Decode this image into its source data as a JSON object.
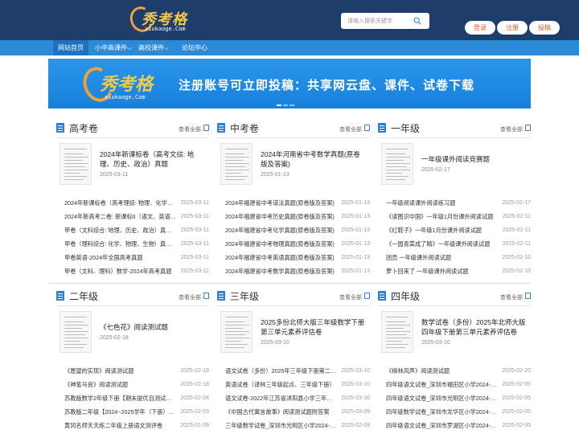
{
  "header": {
    "logo_name": "秀考格",
    "logo_domain": "xiukaoge.Com",
    "search_placeholder": "请输入搜索关键字",
    "buttons": [
      "登录",
      "注册",
      "投稿"
    ]
  },
  "nav": {
    "items": [
      "网站首页",
      "小中高课件⌵",
      "高校课件⌵",
      "论坛中心"
    ]
  },
  "banner": {
    "logo_name": "秀考格",
    "logo_domain": "xiukaoge.Com",
    "text": "注册账号可立即投稿：共享网云盘、课件、试卷下载"
  },
  "more_label": "查看全部",
  "sections": [
    {
      "title": "高考卷",
      "featured": {
        "title": "2024年新课标卷（高考文综: 地理、历史、政治）真题",
        "date": "2025-03-11"
      },
      "items": [
        {
          "title": "2024年新课标卷（高考理综: 物理、化学、生物）真题",
          "date": "2025-03-11"
        },
        {
          "title": "2024年新高考二卷: 新课标II（语文、英语、数学）",
          "date": "2025-03-11"
        },
        {
          "title": "甲卷（文科综合: 地理、历史、政治）真题-2024年高考",
          "date": "2025-03-11"
        },
        {
          "title": "甲卷（理科综合: 化学、物理、生物）真题-2024年",
          "date": "2025-03-11"
        },
        {
          "title": "甲卷英语-2024年全国高考真题",
          "date": "2025-03-11"
        },
        {
          "title": "甲卷（文科、理科）数学-2024年高考真题",
          "date": "2025-03-11"
        }
      ]
    },
    {
      "title": "中考卷",
      "featured": {
        "title": "2024年河南省中考数学真题(原卷版及答案)",
        "date": "2025-01-13"
      },
      "items": [
        {
          "title": "2024年福建省中考道法真题(原卷版及答案)",
          "date": "2025-01-13"
        },
        {
          "title": "2024年福建省中考历史真题(原卷版及答案)",
          "date": "2025-01-13"
        },
        {
          "title": "2024年福建省中考化学真题(原卷版及答案)",
          "date": "2025-01-13"
        },
        {
          "title": "2024年福建省中考物理真题(原卷版及答案)",
          "date": "2025-01-13"
        },
        {
          "title": "2024年福建省中考英语真题(原卷版及答案)",
          "date": "2025-01-13"
        },
        {
          "title": "2024年福建省中考数学真题(原卷版及答案)",
          "date": "2025-01-13"
        }
      ]
    },
    {
      "title": "一年级",
      "featured": {
        "title": "一年级课外阅读竞赛题",
        "date": "2025-02-17"
      },
      "items": [
        {
          "title": "一年级阅读课外阅读练习题",
          "date": "2025-02-17"
        },
        {
          "title": "《读图识中国》一年级1月份课外阅读试题",
          "date": "2025-02-11"
        },
        {
          "title": "《红鞋子》一年级1月份课外阅读试题",
          "date": "2025-02-11"
        },
        {
          "title": "《一园青菜成了精》一年级课外阅读试题",
          "date": "2025-02-11"
        },
        {
          "title": "团员 一年级课外阅读试题",
          "date": "2025-02-10"
        },
        {
          "title": "萝卜回来了 一年级课外阅读试题",
          "date": "2025-02-10"
        }
      ]
    },
    {
      "title": "二年级",
      "featured": {
        "title": "《七色花》阅读测试题",
        "date": "2025-02-18"
      },
      "items": [
        {
          "title": "《愿望的实现》阅读测试题",
          "date": "2025-02-18"
        },
        {
          "title": "《神笔马良》阅读测试题",
          "date": "2025-02-18"
        },
        {
          "title": "苏教版数学2年级下册【期末提优自测试卷】",
          "date": "2025-02-04"
        },
        {
          "title": "苏教版二年级【2024~2025学年（下册）期中测试卷】",
          "date": "2025-02-03"
        },
        {
          "title": "黄冈名师天天练二年级上册语文测评卷",
          "date": "2025-01-09"
        }
      ]
    },
    {
      "title": "三年级",
      "featured": {
        "title": "2025多份北师大版三年级数学下册第三单元素养评估卷",
        "date": "2025-03-10"
      },
      "items": [
        {
          "title": "语文试卷（多份）2025年三年级下册第二单元",
          "date": "2025-03-10"
        },
        {
          "title": "英语试卷（译林三年级起点、三年级下册）",
          "date": "2025-03-10"
        },
        {
          "title": "语文试卷-2022年江苏省沭阳县小学三年级期末",
          "date": "2025-03-10"
        },
        {
          "title": "《中国古代寓言故事》阅读测试题附答案",
          "date": "2025-03-09"
        },
        {
          "title": "三年级数学试卷_深圳市光明区小学2024-2025",
          "date": "2025-02-09"
        }
      ]
    },
    {
      "title": "四年级",
      "featured": {
        "title": "数学试卷（多份）2025年北师大版四年级下册第三单元素养评估卷",
        "date": "2025-03-10"
      },
      "items": [
        {
          "title": "《柳林风声》阅读测试题",
          "date": "2025-02-20"
        },
        {
          "title": "四年级语文试卷_深圳市福田区小学2024-2025",
          "date": "2025-02-05"
        },
        {
          "title": "四年级语文试卷_深圳市光明区小学2024-2025",
          "date": "2025-02-05"
        },
        {
          "title": "四年级数学试卷_深圳市龙华区小学2024-2025",
          "date": "2025-02-05"
        },
        {
          "title": "四年级语文试卷_深圳市罗湖区小学2024-2025",
          "date": "2025-02-05"
        }
      ]
    }
  ]
}
